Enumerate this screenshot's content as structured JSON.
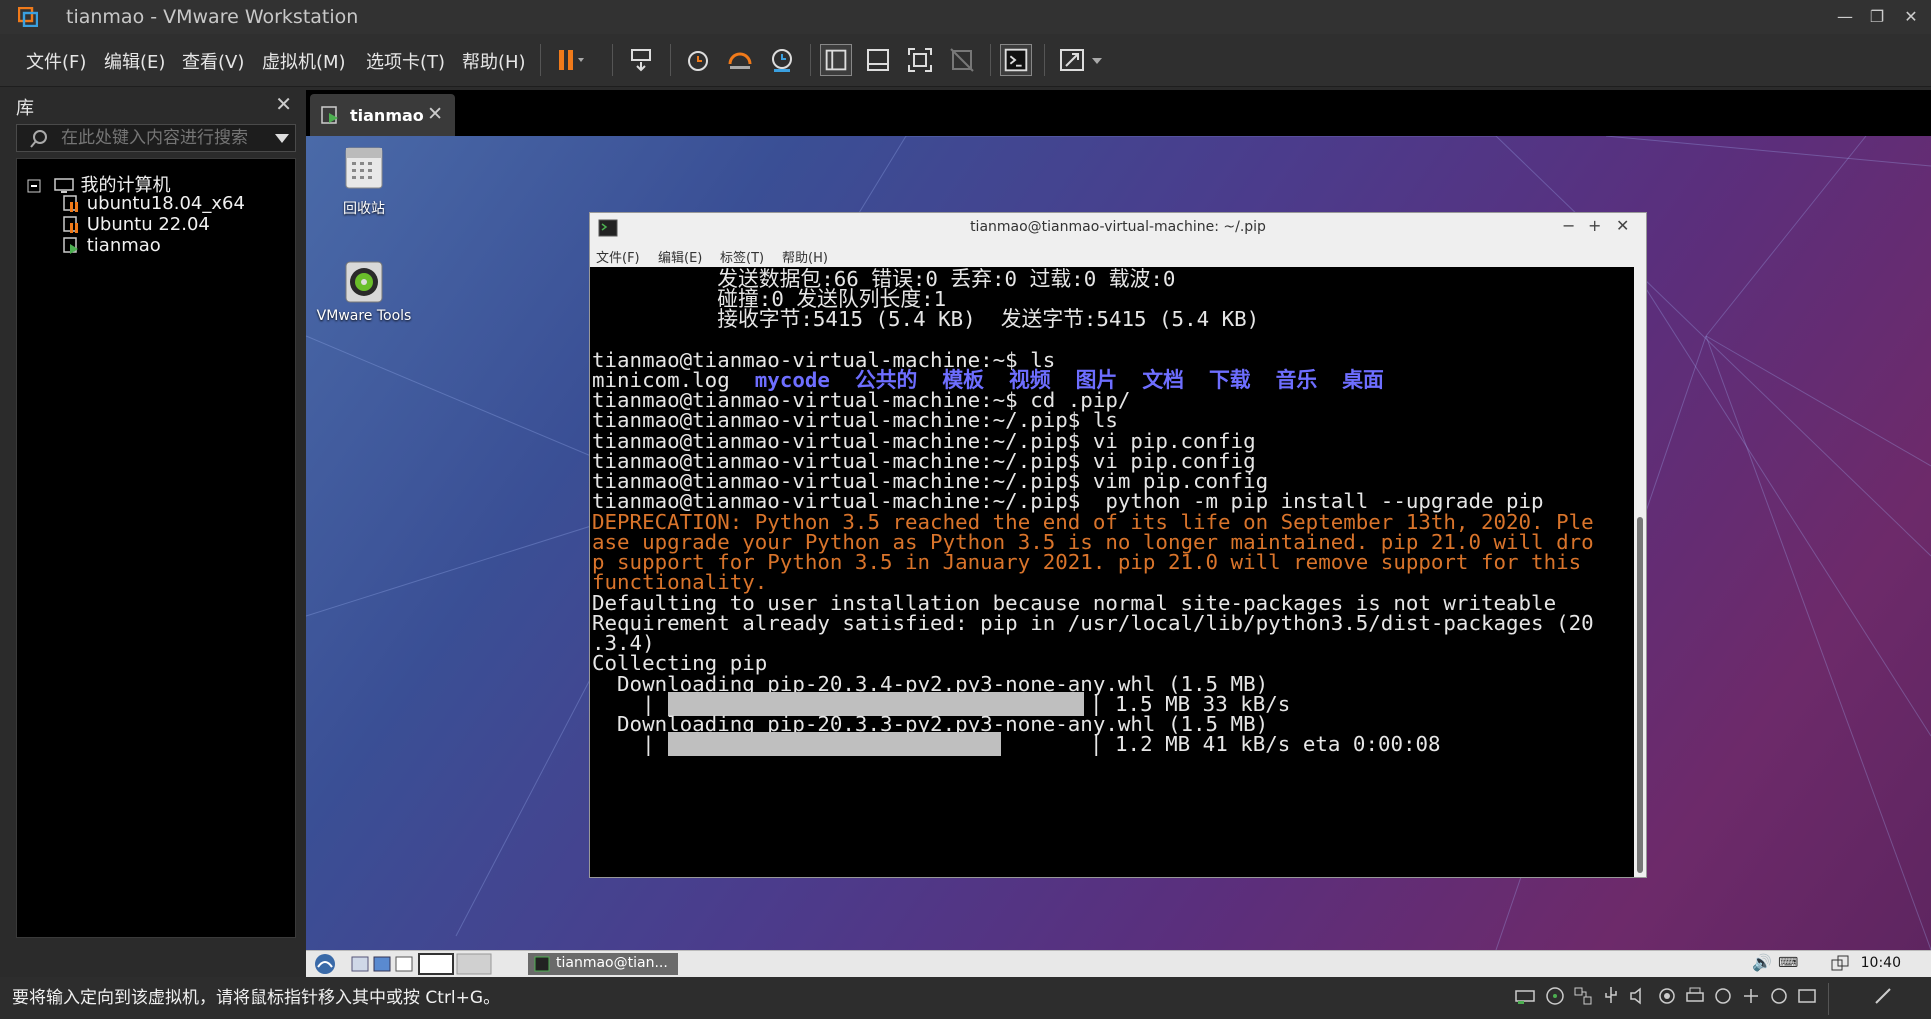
{
  "window": {
    "title": "tianmao - VMware Workstation",
    "controls": [
      "—",
      "❐",
      "✕"
    ]
  },
  "menu": [
    "文件(F)",
    "编辑(E)",
    "查看(V)",
    "虚拟机(M)",
    "选项卡(T)",
    "帮助(H)"
  ],
  "library": {
    "title": "库",
    "close": "✕",
    "search_placeholder": "在此处键入内容进行搜索",
    "tree": {
      "root": "我的计算机",
      "items": [
        "ubuntu18.04_x64",
        "Ubuntu 22.04",
        "tianmao"
      ]
    }
  },
  "vm_tab": {
    "label": "tianmao",
    "close": "✕"
  },
  "desktop_icons": [
    {
      "label": "回收站",
      "icon": "trash-icon"
    },
    {
      "label": "VMware Tools",
      "icon": "disc-icon"
    }
  ],
  "terminal": {
    "title": "tianmao@tianmao-virtual-machine: ~/.pip",
    "controls": [
      "−",
      "+",
      "✕"
    ],
    "menu": [
      "文件(F)",
      "编辑(E)",
      "标签(T)",
      "帮助(H)"
    ],
    "lines": [
      "          发送数据包:66 错误:0 丢弃:0 过载:0 载波:0",
      "          碰撞:0 发送队列长度:1",
      "          接收字节:5415 (5.4 KB)  发送字节:5415 (5.4 KB)",
      "",
      "tianmao@tianmao-virtual-machine:~$ ls"
    ],
    "ls_output": {
      "file": "minicom.log",
      "dirs": [
        "mycode",
        "公共的",
        "模板",
        "视频",
        "图片",
        "文档",
        "下载",
        "音乐",
        "桌面"
      ]
    },
    "lines2": [
      "tianmao@tianmao-virtual-machine:~$ cd .pip/",
      "tianmao@tianmao-virtual-machine:~/.pip$ ls",
      "tianmao@tianmao-virtual-machine:~/.pip$ vi pip.config",
      "tianmao@tianmao-virtual-machine:~/.pip$ vi pip.config",
      "tianmao@tianmao-virtual-machine:~/.pip$ vim pip.config",
      "tianmao@tianmao-virtual-machine:~/.pip$  python -m pip install --upgrade pip"
    ],
    "warning": [
      "DEPRECATION: Python 3.5 reached the end of its life on September 13th, 2020. Ple",
      "ase upgrade your Python as Python 3.5 is no longer maintained. pip 21.0 will dro",
      "p support for Python 3.5 in January 2021. pip 21.0 will remove support for this",
      "functionality."
    ],
    "lines3": [
      "Defaulting to user installation because normal site-packages is not writeable",
      "Requirement already satisfied: pip in /usr/local/lib/python3.5/dist-packages (20",
      ".3.4)",
      "Collecting pip",
      "  Downloading pip-20.3.4-py2.py3-none-any.whl (1.5 MB)"
    ],
    "progress1": {
      "text": "| 1.5 MB 33 kB/s",
      "fraction": 1.0
    },
    "download2": "  Downloading pip-20.3.3-py2.py3-none-any.whl (1.5 MB)",
    "progress2": {
      "text": "| 1.2 MB 41 kB/s eta 0:00:08",
      "fraction": 0.8
    }
  },
  "guest_taskbar": {
    "task": "tianmao@tian...",
    "clock": "10:40"
  },
  "status": {
    "message": "要将输入定向到该虚拟机，请将鼠标指针移入其中或按 Ctrl+G。"
  },
  "colors": {
    "accent_orange": "#f07a1a",
    "dir_blue": "#6e6eff",
    "warn_orange": "#d9742b"
  }
}
